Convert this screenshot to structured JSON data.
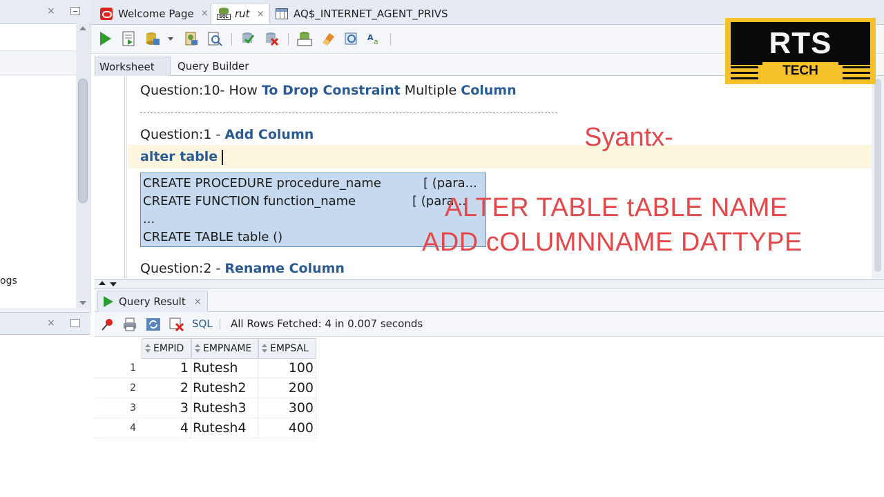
{
  "left_panel": {
    "partial_label": "ogs",
    "close_glyph": "×"
  },
  "editor_tabs": [
    {
      "label": "Welcome Page",
      "icon": "oracle-icon",
      "close": "×"
    },
    {
      "label": "rut",
      "icon": "sql-worksheet-icon",
      "close": "×"
    },
    {
      "label": "AQ$_INTERNET_AGENT_PRIVS",
      "icon": "table-icon"
    }
  ],
  "sql_icon_label": "SQL",
  "worksheet_tabs": {
    "worksheet": "Worksheet",
    "query_builder": "Query Builder"
  },
  "editor": {
    "line1_prefix": "Question:10- How ",
    "line1_kw1": "To Drop Constraint",
    "line1_mid": " Multiple ",
    "line1_kw2": "Column",
    "line2_prefix": "Question:1 - ",
    "line2_kw": "Add Column",
    "line3_kw": "alter table",
    "line4_prefix": "Question:2 - ",
    "line4_kw": "Rename Column"
  },
  "completion_popup": {
    "row1_left": "CREATE PROCEDURE procedure_name",
    "row1_right": "[ (para...",
    "row2_left": "CREATE FUNCTION function_name",
    "row2_right": "[ (para...",
    "row3": "...",
    "row4": "CREATE TABLE table ()"
  },
  "annotation": {
    "title": "Syantx-",
    "line1": "ALTER TABLE tABLE NAME",
    "line2": "ADD cOLUMNNAME DATTYPE",
    "color": "#e4484a"
  },
  "logo": {
    "top": "RTS",
    "bottom": "TECH",
    "bg_color": "#f7c12a"
  },
  "result": {
    "tab_label": "Query Result",
    "tab_close": "×",
    "sql_link": "SQL",
    "status": "All Rows Fetched: 4 in 0.007 seconds",
    "columns": [
      "EMPID",
      "EMPNAME",
      "EMPSAL"
    ],
    "rows": [
      {
        "n": "1",
        "empid": "1",
        "empname": "Rutesh",
        "empsal": "100"
      },
      {
        "n": "2",
        "empid": "2",
        "empname": "Rutesh2",
        "empsal": "200"
      },
      {
        "n": "3",
        "empid": "3",
        "empname": "Rutesh3",
        "empsal": "300"
      },
      {
        "n": "4",
        "empid": "4",
        "empname": "Rutesh4",
        "empsal": "400"
      }
    ]
  }
}
